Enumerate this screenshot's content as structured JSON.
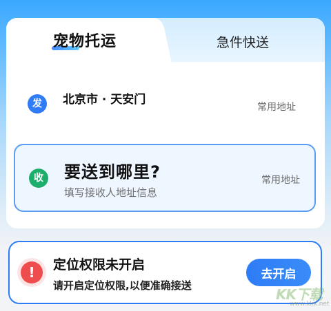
{
  "tabs": [
    {
      "label": "宠物托运",
      "active": true
    },
    {
      "label": "急件快送",
      "active": false
    }
  ],
  "sender": {
    "badge": "发",
    "address": "北京市 · 天安门",
    "common_link": "常用地址"
  },
  "receiver": {
    "badge": "收",
    "title": "要送到哪里?",
    "hint": "填写接收人地址信息",
    "common_link": "常用地址"
  },
  "permission": {
    "icon": "alert-icon",
    "title": "定位权限未开启",
    "description": "请开启定位权限,以便准确接送",
    "button_label": "去开启"
  },
  "watermark": {
    "text": "KK下载",
    "url": "www.kkx.net"
  },
  "colors": {
    "accent": "#2f7cf6",
    "receiver_badge": "#1cae6b",
    "warning": "#ef4d4d"
  }
}
